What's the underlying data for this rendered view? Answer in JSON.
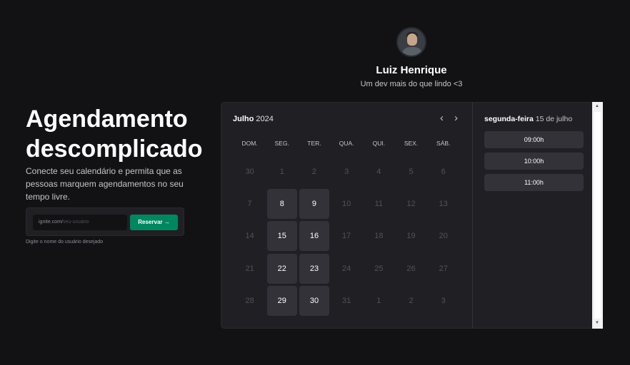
{
  "profile": {
    "name": "Luiz Henrique",
    "bio": "Um dev mais do que lindo <3"
  },
  "hero": {
    "title": "Agendamento descomplicado",
    "description": "Conecte seu calendário e permita que as pessoas marquem agendamentos no seu tempo livre.",
    "input_prefix": "ignite.com/",
    "input_placeholder": "seu-usuário",
    "button_label": "Reservar →",
    "hint": "Digite o nome do usuário desejado"
  },
  "calendar": {
    "month": "Julho",
    "year": "2024",
    "prev_icon": "‹",
    "next_icon": "›",
    "weekdays": [
      "DOM.",
      "SEG.",
      "TER.",
      "QUA.",
      "QUI.",
      "SEX.",
      "SÁB."
    ],
    "weeks": [
      [
        {
          "d": "30",
          "a": false
        },
        {
          "d": "1",
          "a": false
        },
        {
          "d": "2",
          "a": false
        },
        {
          "d": "3",
          "a": false
        },
        {
          "d": "4",
          "a": false
        },
        {
          "d": "5",
          "a": false
        },
        {
          "d": "6",
          "a": false
        }
      ],
      [
        {
          "d": "7",
          "a": false
        },
        {
          "d": "8",
          "a": true
        },
        {
          "d": "9",
          "a": true
        },
        {
          "d": "10",
          "a": false
        },
        {
          "d": "11",
          "a": false
        },
        {
          "d": "12",
          "a": false
        },
        {
          "d": "13",
          "a": false
        }
      ],
      [
        {
          "d": "14",
          "a": false
        },
        {
          "d": "15",
          "a": true
        },
        {
          "d": "16",
          "a": true
        },
        {
          "d": "17",
          "a": false
        },
        {
          "d": "18",
          "a": false
        },
        {
          "d": "19",
          "a": false
        },
        {
          "d": "20",
          "a": false
        }
      ],
      [
        {
          "d": "21",
          "a": false
        },
        {
          "d": "22",
          "a": true
        },
        {
          "d": "23",
          "a": true
        },
        {
          "d": "24",
          "a": false
        },
        {
          "d": "25",
          "a": false
        },
        {
          "d": "26",
          "a": false
        },
        {
          "d": "27",
          "a": false
        }
      ],
      [
        {
          "d": "28",
          "a": false
        },
        {
          "d": "29",
          "a": true
        },
        {
          "d": "30",
          "a": true
        },
        {
          "d": "31",
          "a": false
        },
        {
          "d": "1",
          "a": false
        },
        {
          "d": "2",
          "a": false
        },
        {
          "d": "3",
          "a": false
        }
      ]
    ]
  },
  "times": {
    "weekday": "segunda-feira",
    "date": "15 de julho",
    "slots": [
      "09:00h",
      "10:00h",
      "11:00h"
    ]
  },
  "colors": {
    "background": "#121214",
    "panel": "#202024",
    "available_day": "#323238",
    "accent": "#00875f"
  }
}
